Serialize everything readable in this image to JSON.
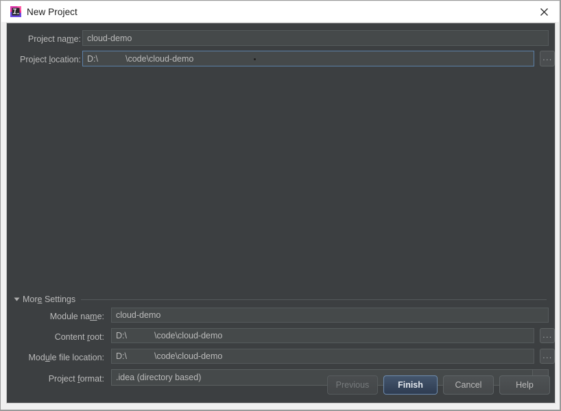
{
  "window": {
    "title": "New Project",
    "icon": "intellij-idea-icon",
    "close_label": "✕"
  },
  "top_form": {
    "project_name": {
      "label_before": "Project na",
      "label_mnemonic": "m",
      "label_after": "e:",
      "value": "cloud-demo"
    },
    "project_location": {
      "label_before": "Project ",
      "label_mnemonic": "l",
      "label_after": "ocation:",
      "value_prefix": "D:\\",
      "value_suffix": "\\code\\cloud-demo",
      "browse_label": "...",
      "focused": true
    }
  },
  "more_settings": {
    "label_before": "Mor",
    "label_mnemonic": "e",
    "label_after": " Settings",
    "expanded": true,
    "module_name": {
      "label_before": "Module na",
      "label_mnemonic": "m",
      "label_after": "e:",
      "value": "cloud-demo"
    },
    "content_root": {
      "label_before": "Content ",
      "label_mnemonic": "r",
      "label_after": "oot:",
      "value_prefix": "D:\\",
      "value_suffix": "\\code\\cloud-demo",
      "browse_label": "..."
    },
    "module_file_location": {
      "label_before": "Mod",
      "label_mnemonic": "u",
      "label_after": "le file location:",
      "value_prefix": "D:\\",
      "value_suffix": "\\code\\cloud-demo",
      "browse_label": "..."
    },
    "project_format": {
      "label_before": "Project ",
      "label_mnemonic": "f",
      "label_after": "ormat:",
      "value": ".idea (directory based)"
    }
  },
  "buttons": {
    "previous": "Previous",
    "finish": "Finish",
    "cancel": "Cancel",
    "help": "Help"
  },
  "colors": {
    "dialog_background": "#3c3f41",
    "field_background": "#45494a",
    "text": "#bbbbbb",
    "focus_border": "#5c81a8",
    "default_button": "#2e3c51",
    "titlebar_background": "#ffffff"
  }
}
